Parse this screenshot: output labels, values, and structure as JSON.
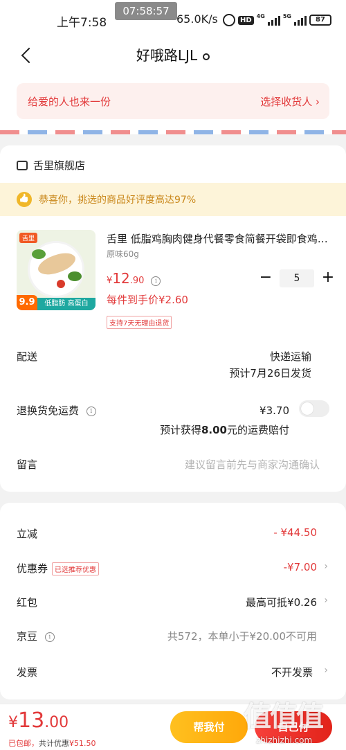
{
  "status_bar": {
    "time": "上午7:58",
    "clock_overlay": "07:58:57",
    "net_speed": "65.0K/s",
    "hd_label": "HD",
    "net1": "4G",
    "net2": "5G",
    "battery": "87"
  },
  "nav": {
    "title": "好哦路LJL",
    "back_icon": "chevron-left-icon",
    "location_icon": "location-pin-icon"
  },
  "gift_bar": {
    "left_text": "给爱的人也来一份",
    "right_text": "选择收货人 ›"
  },
  "shop": {
    "name": "舌里旗舰店",
    "praise_text": "恭喜你，挑选的商品好评度高达97%"
  },
  "product": {
    "brand_tag": "舌里",
    "image_price_tag": "9.9",
    "image_strip_text": "低脂肪 高蛋白",
    "name": "舌里 低脂鸡胸肉健身代餐零食简餐开袋即食鸡胸肉...",
    "spec": "原味60g",
    "currency": "¥",
    "price_int": "12",
    "price_dec": ".90",
    "unit_price": "每件到手价¥2.60",
    "return_badge": "支持7天无理由退货",
    "quantity": "5",
    "minus": "−",
    "plus": "+"
  },
  "delivery": {
    "label": "配送",
    "method": "快递运输",
    "eta": "预计7月26日发货"
  },
  "return_shipping": {
    "label": "退换货免运费",
    "price": "¥3.70",
    "note_prefix": "预计获得",
    "note_amount": "8.00",
    "note_suffix": "元的运费赔付",
    "toggle_on": false
  },
  "message": {
    "label": "留言",
    "placeholder": "建议留言前先与商家沟通确认"
  },
  "discounts": {
    "instant_label": "立减",
    "instant_value": "- ¥44.50",
    "coupon_label": "优惠券",
    "coupon_badge": "已选推荐优惠",
    "coupon_value": "-¥7.00",
    "redpacket_label": "红包",
    "redpacket_value": "最高可抵¥0.26",
    "jd_bean_label": "京豆",
    "jd_bean_value": "共572，本单小于¥20.00不可用",
    "invoice_label": "发票",
    "invoice_value": "不开发票"
  },
  "bottom_bar": {
    "currency": "¥",
    "total_int": "13",
    "total_dec": ".00",
    "free_shipping": "已包邮，",
    "saved_label": "共计优惠",
    "saved_value": "¥51.50",
    "help_pay": "帮我付",
    "self_pay": "自己付"
  },
  "watermark": {
    "text": "值值值",
    "url": "zhizhizhi.com"
  },
  "colors": {
    "accent_red": "#e2393a",
    "help_yellow": "#ffb414",
    "praise_bg": "#fdf4d9",
    "gift_bg": "#fdf0ee"
  }
}
